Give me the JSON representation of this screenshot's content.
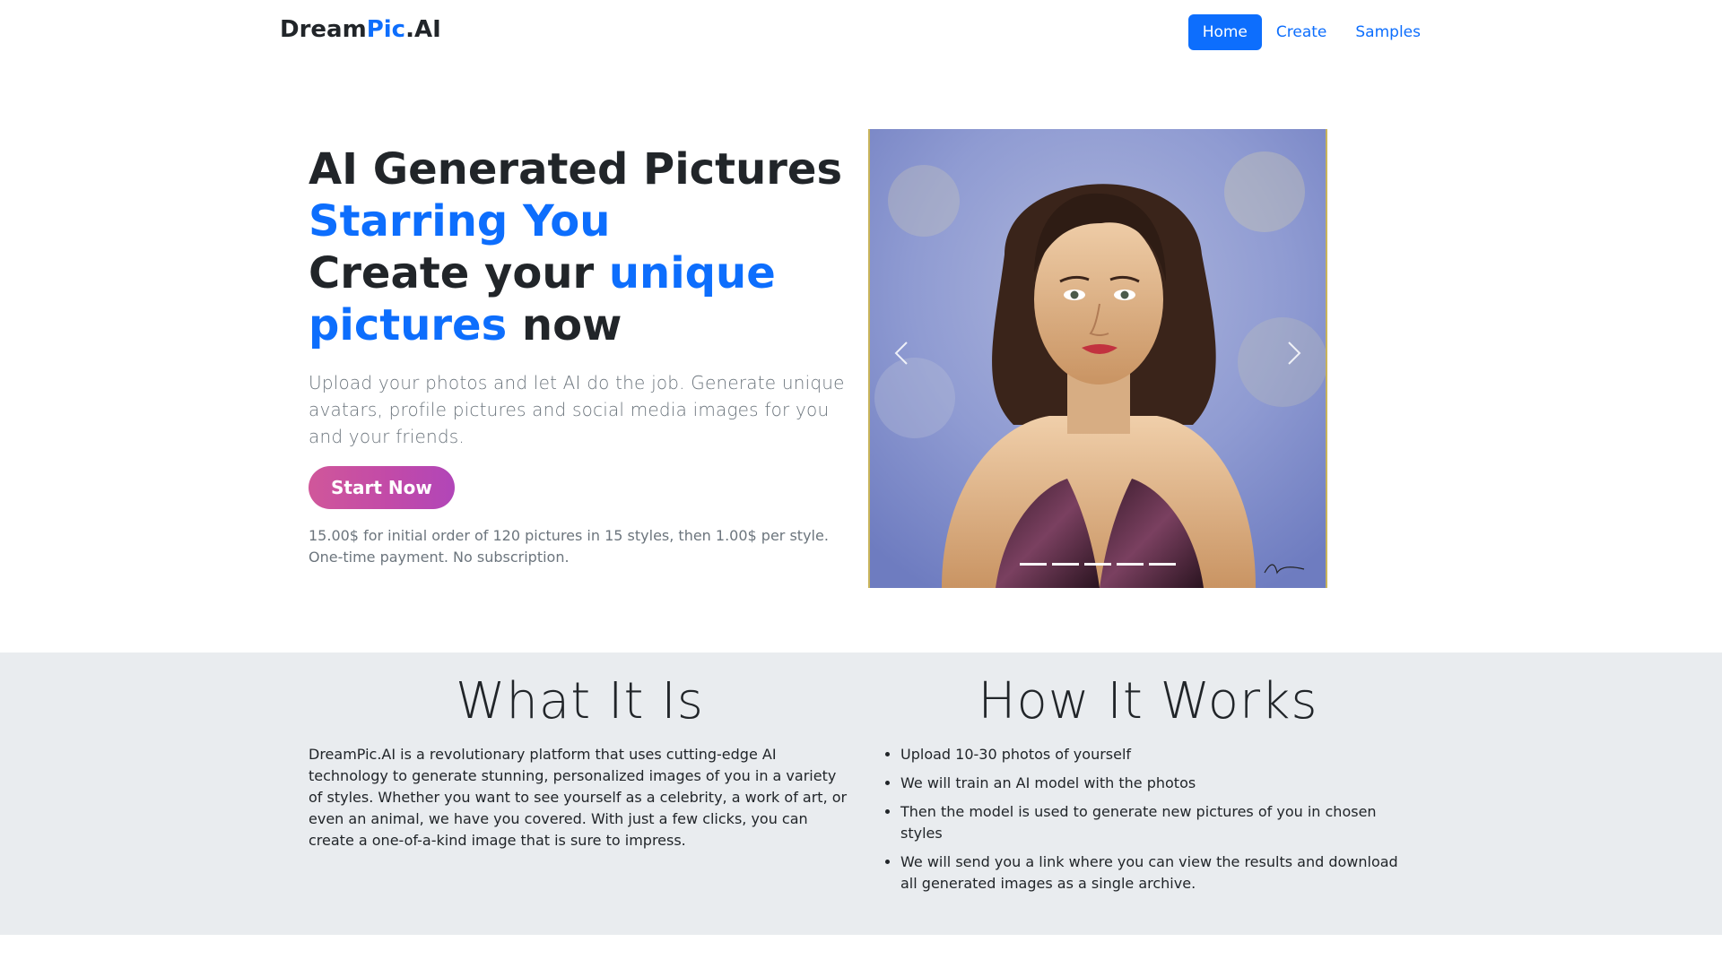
{
  "brand": {
    "part1": "Dream",
    "part2": "Pic",
    "part3": ".AI"
  },
  "nav": {
    "home": "Home",
    "create": "Create",
    "samples": "Samples"
  },
  "hero": {
    "title_line1": "AI Generated Pictures",
    "title_line2": "Starring You",
    "title_line3a": "Create your ",
    "title_line3b": "unique",
    "title_line4a": "pictures",
    "title_line4b": " now",
    "lead": "Upload your photos and let AI do the job. Generate unique avatars, profile pictures and social media images for you and your friends.",
    "cta": "Start Now",
    "pricing_line1": "15.00$ for initial order of 120 pictures in 15 styles, then 1.00$ per style.",
    "pricing_line2": "One-time payment. No subscription."
  },
  "carousel": {
    "slide_count": 5,
    "active_index": 0
  },
  "what": {
    "title": "What It Is",
    "text": "DreamPic.AI is a revolutionary platform that uses cutting-edge AI technology to generate stunning, personalized images of you in a variety of styles. Whether you want to see yourself as a celebrity, a work of art, or even an animal, we have you covered. With just a few clicks, you can create a one-of-a-kind image that is sure to impress."
  },
  "how": {
    "title": "How It Works",
    "steps": [
      "Upload 10-30 photos of yourself",
      "We will train an AI model with the photos",
      "Then the model is used to generate new pictures of you in chosen styles",
      "We will send you a link where you can view the results and download all generated images as a single archive."
    ]
  },
  "colors": {
    "primary": "#0d6efd",
    "section_bg": "#e9ecef",
    "cta_gradient": [
      "#d0579a",
      "#b146b8"
    ]
  }
}
